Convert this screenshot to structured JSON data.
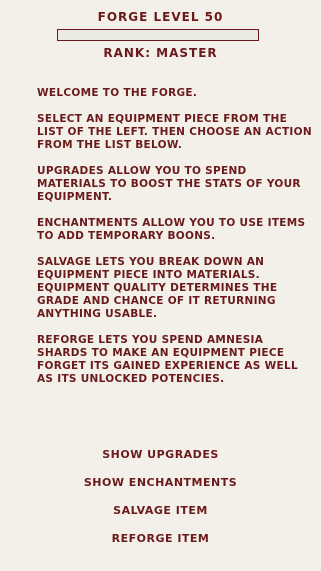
{
  "forge": {
    "level_title": "FORGE LEVEL 50",
    "progress": 0.0,
    "rank": "RANK: MASTER"
  },
  "paragraphs": [
    "WELCOME TO THE FORGE.",
    "SELECT AN EQUIPMENT PIECE FROM THE LIST OF THE LEFT. THEN CHOOSE AN ACTION FROM THE LIST BELOW.",
    "UPGRADES ALLOW YOU TO SPEND MATERIALS TO BOOST THE STATS OF YOUR EQUIPMENT.",
    "ENCHANTMENTS ALLOW YOU TO USE ITEMS TO ADD TEMPORARY BOONS.",
    "SALVAGE LETS YOU BREAK DOWN AN EQUIPMENT PIECE INTO MATERIALS. EQUIPMENT QUALITY DETERMINES THE GRADE AND CHANCE OF IT RETURNING ANYTHING USABLE.",
    "REFORGE LETS YOU SPEND AMNESIA SHARDS TO MAKE AN EQUIPMENT PIECE FORGET ITS GAINED EXPERIENCE AS WELL AS ITS UNLOCKED POTENCIES."
  ],
  "actions": [
    "SHOW UPGRADES",
    "SHOW ENCHANTMENTS",
    "SALVAGE ITEM",
    "REFORGE ITEM"
  ],
  "colors": {
    "text": "#6b1a1c",
    "background": "#f2f0e8"
  }
}
